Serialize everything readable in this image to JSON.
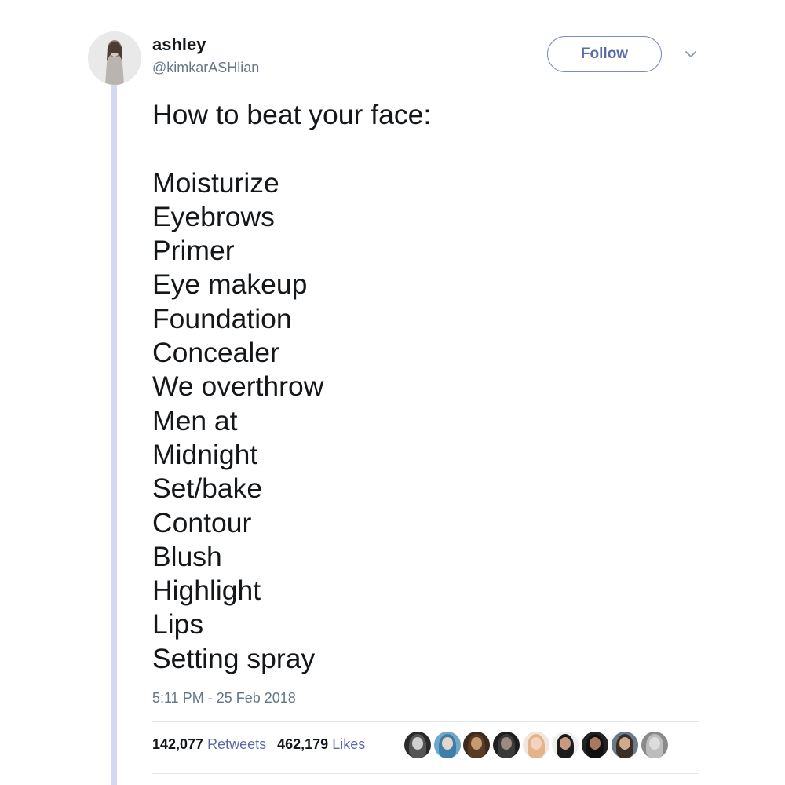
{
  "user": {
    "display_name": "ashley",
    "handle": "@kimkarASHlian"
  },
  "header": {
    "follow_label": "Follow",
    "caret_icon": "chevron-down-icon"
  },
  "tweet": {
    "heading": "How to beat your face:",
    "lines": [
      "Moisturize",
      "Eyebrows",
      "Primer",
      "Eye makeup",
      "Foundation",
      "Concealer",
      "We overthrow",
      "Men at",
      "Midnight",
      "Set/bake",
      "Contour",
      "Blush",
      "Highlight",
      "Lips",
      "Setting spray"
    ],
    "timestamp": "5:11 PM - 25 Feb 2018"
  },
  "stats": {
    "retweets_count": "142,077",
    "retweets_label": "Retweets",
    "likes_count": "462,179",
    "likes_label": "Likes"
  },
  "colors": {
    "accent": "#5a6aa8",
    "thread_line": "#d4d8f0",
    "muted_text": "#657786"
  }
}
